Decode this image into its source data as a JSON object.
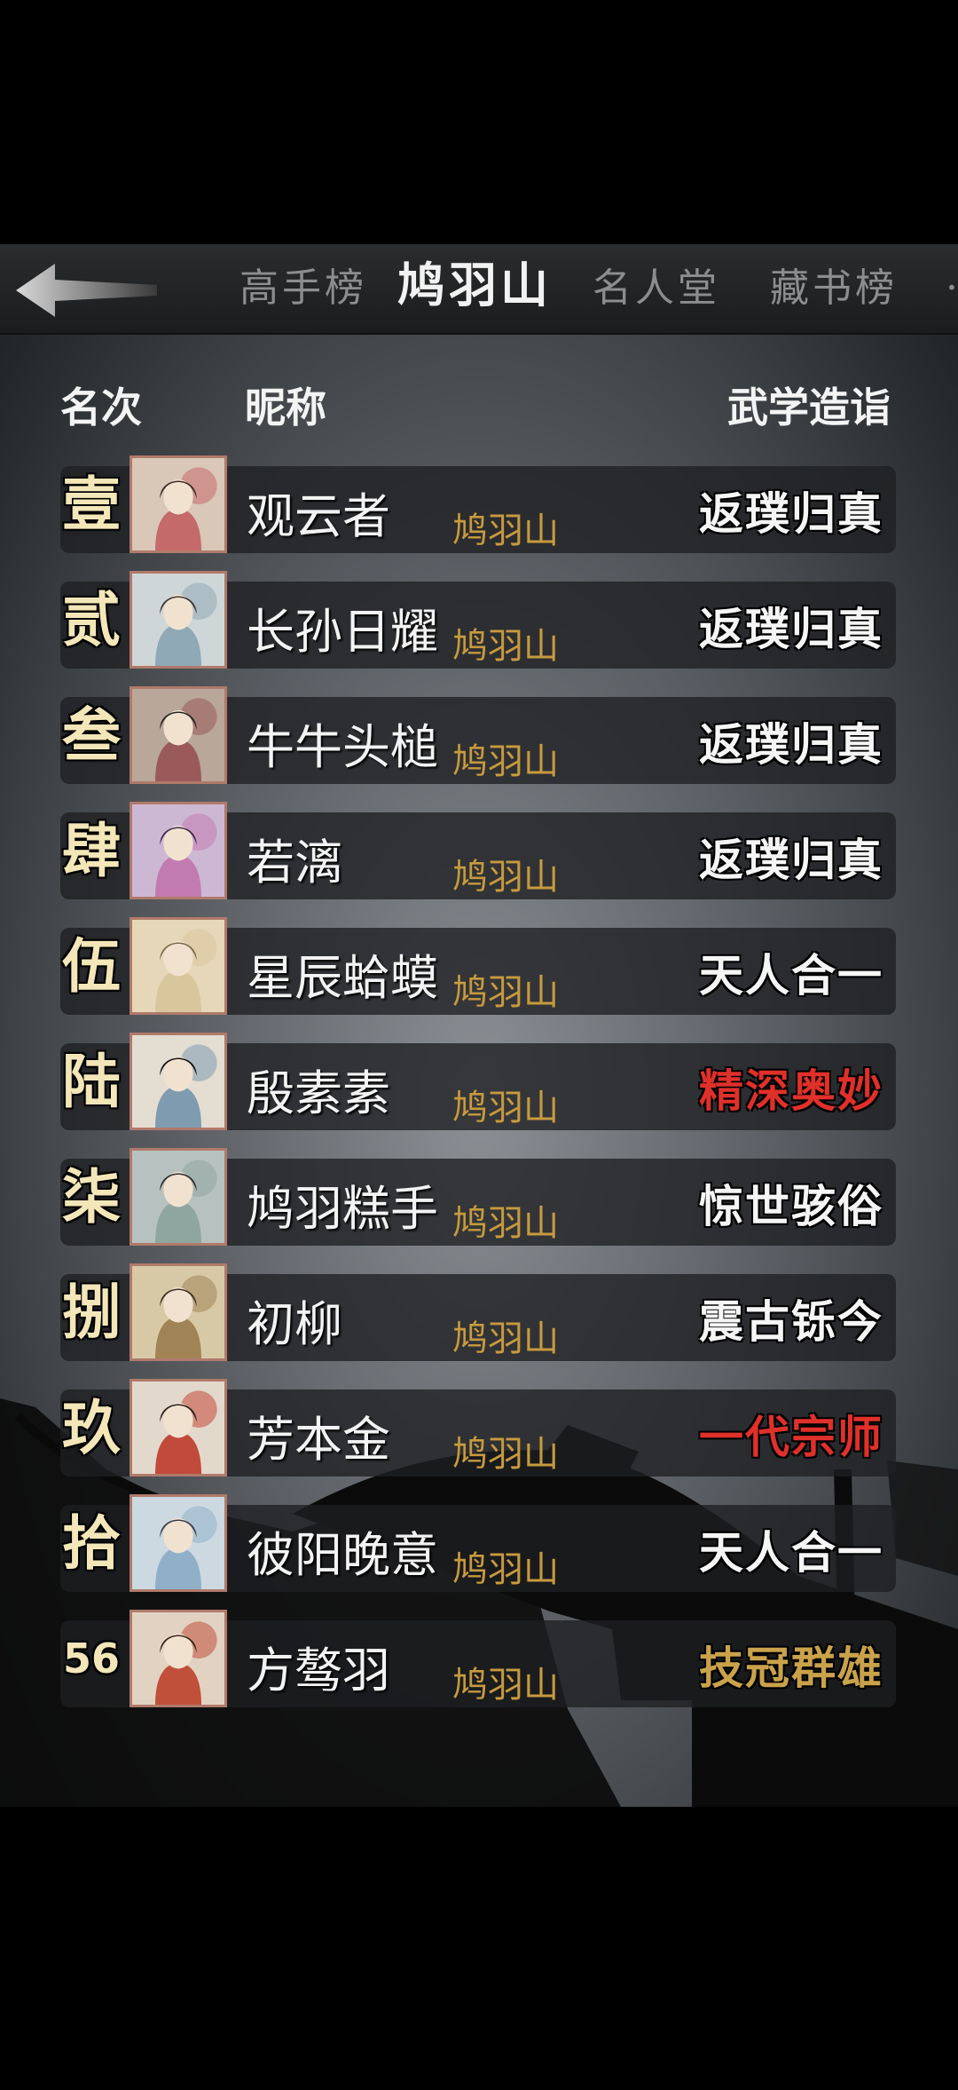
{
  "tabs": [
    {
      "label": "高手榜"
    },
    {
      "label": "鸠羽山"
    },
    {
      "label": "名人堂"
    },
    {
      "label": "藏书榜"
    }
  ],
  "headers": {
    "rank": "名次",
    "nickname": "昵称",
    "skill": "武学造诣"
  },
  "rows": [
    {
      "rank": "壹",
      "name": "观云者",
      "sect": "鸠羽山",
      "level": "返璞归真",
      "level_color": "#f5f5f5"
    },
    {
      "rank": "贰",
      "name": "长孙日耀",
      "sect": "鸠羽山",
      "level": "返璞归真",
      "level_color": "#f5f5f5"
    },
    {
      "rank": "叁",
      "name": "牛牛头槌",
      "sect": "鸠羽山",
      "level": "返璞归真",
      "level_color": "#f5f5f5"
    },
    {
      "rank": "肆",
      "name": "若漓",
      "sect": "鸠羽山",
      "level": "返璞归真",
      "level_color": "#f5f5f5"
    },
    {
      "rank": "伍",
      "name": "星辰蛤蟆",
      "sect": "鸠羽山",
      "level": "天人合一",
      "level_color": "#f5f5f5"
    },
    {
      "rank": "陆",
      "name": "殷素素",
      "sect": "鸠羽山",
      "level": "精深奥妙",
      "level_color": "#e0302a"
    },
    {
      "rank": "柒",
      "name": "鸠羽糕手",
      "sect": "鸠羽山",
      "level": "惊世骇俗",
      "level_color": "#f5f5f5"
    },
    {
      "rank": "捌",
      "name": "初柳",
      "sect": "鸠羽山",
      "level": "震古铄今",
      "level_color": "#f5f5f5"
    },
    {
      "rank": "玖",
      "name": "芳本金",
      "sect": "鸠羽山",
      "level": "一代宗师",
      "level_color": "#e0302a"
    },
    {
      "rank": "拾",
      "name": "彼阳晚意",
      "sect": "鸠羽山",
      "level": "天人合一",
      "level_color": "#f5f5f5"
    },
    {
      "rank": "56",
      "name": "方骜羽",
      "sect": "鸠羽山",
      "level": "技冠群雄",
      "level_color": "#c9a24a"
    }
  ],
  "colors": {
    "sect": "#c79a3e",
    "rank": "#f3e6b8",
    "accent_red": "#e0302a",
    "accent_gold": "#c9a24a"
  }
}
